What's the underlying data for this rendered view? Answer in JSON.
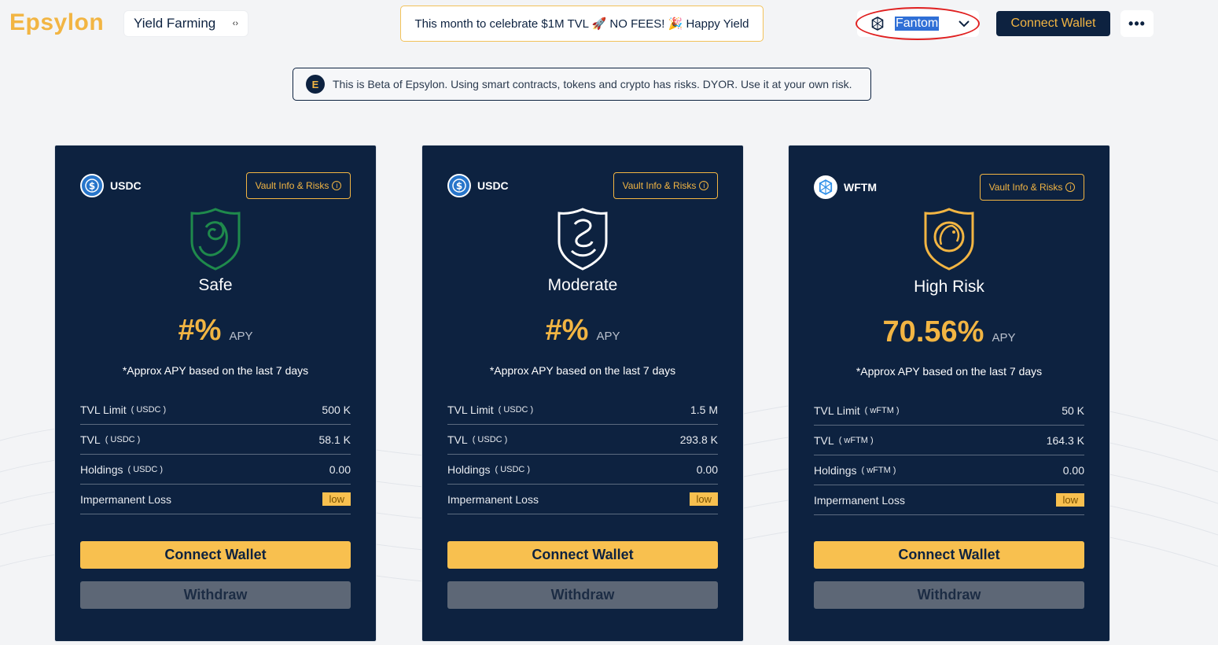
{
  "header": {
    "logo": "Epsylon",
    "section_select": "Yield Farming",
    "promo": "This month to celebrate $1M TVL 🚀 NO FEES! 🎉 Happy Yield",
    "network": "Fantom",
    "connect_label": "Connect Wallet",
    "more": "•••"
  },
  "beta": {
    "badge": "E",
    "text": "This is Beta of Epsylon. Using smart contracts, tokens and crypto has risks. DYOR. Use it at your own risk."
  },
  "cards": [
    {
      "token": "USDC",
      "vault_label": "Vault Info & Risks",
      "risk": "Safe",
      "apy": "#%",
      "apy_label": "APY",
      "approx": "*Approx APY based on the last 7 days",
      "tvl_limit_label": "TVL Limit",
      "tvl_limit_unit": "( USDC )",
      "tvl_limit": "500 K",
      "tvl_label": "TVL",
      "tvl_unit": "( USDC )",
      "tvl": "58.1 K",
      "holdings_label": "Holdings",
      "holdings_unit": "( USDC )",
      "holdings": "0.00",
      "il_label": "Impermanent Loss",
      "il": "low",
      "connect": "Connect Wallet",
      "withdraw": "Withdraw"
    },
    {
      "token": "USDC",
      "vault_label": "Vault Info & Risks",
      "risk": "Moderate",
      "apy": "#%",
      "apy_label": "APY",
      "approx": "*Approx APY based on the last 7 days",
      "tvl_limit_label": "TVL Limit",
      "tvl_limit_unit": "( USDC )",
      "tvl_limit": "1.5 M",
      "tvl_label": "TVL",
      "tvl_unit": "( USDC )",
      "tvl": "293.8 K",
      "holdings_label": "Holdings",
      "holdings_unit": "( USDC )",
      "holdings": "0.00",
      "il_label": "Impermanent Loss",
      "il": "low",
      "connect": "Connect Wallet",
      "withdraw": "Withdraw"
    },
    {
      "token": "WFTM",
      "vault_label": "Vault Info & Risks",
      "risk": "High Risk",
      "apy": "70.56%",
      "apy_label": "APY",
      "approx": "*Approx APY based on the last 7 days",
      "tvl_limit_label": "TVL Limit",
      "tvl_limit_unit": "( wFTM )",
      "tvl_limit": "50 K",
      "tvl_label": "TVL",
      "tvl_unit": "( wFTM )",
      "tvl": "164.3 K",
      "holdings_label": "Holdings",
      "holdings_unit": "( wFTM )",
      "holdings": "0.00",
      "il_label": "Impermanent Loss",
      "il": "low",
      "connect": "Connect Wallet",
      "withdraw": "Withdraw"
    }
  ],
  "colors": {
    "navy": "#0d2240",
    "gold": "#f2b543",
    "safe_green": "#1f8a4c",
    "highlight_red": "#e02020"
  }
}
